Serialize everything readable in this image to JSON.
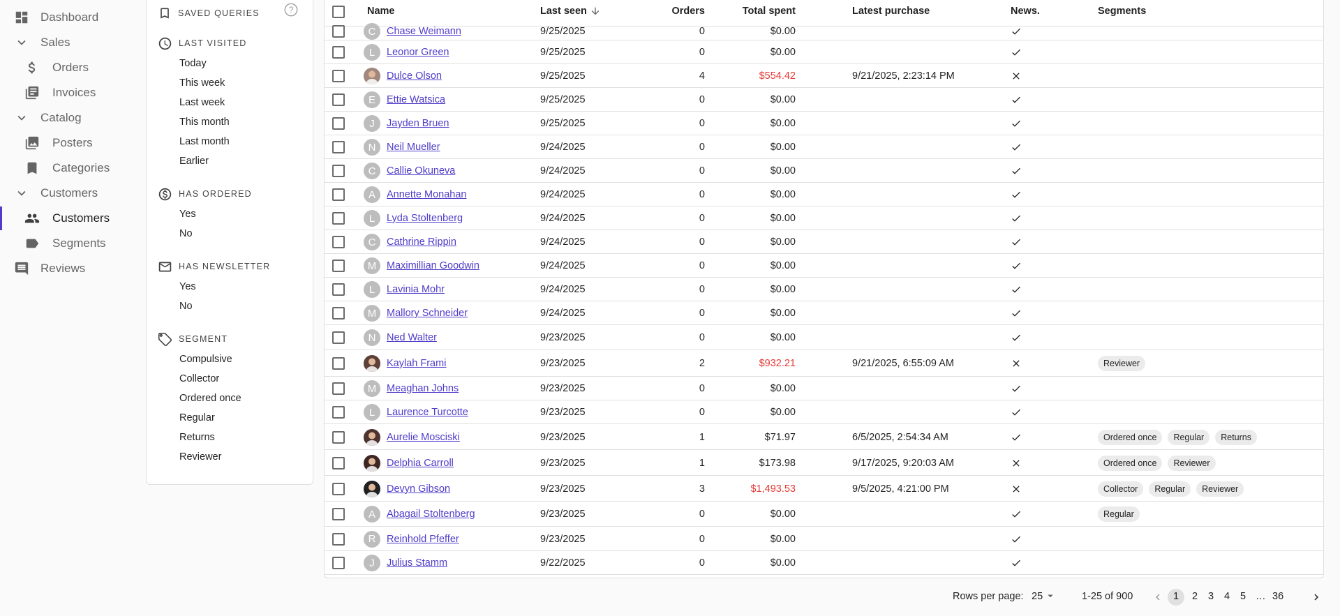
{
  "nav": {
    "items": [
      {
        "label": "Dashboard",
        "icon": "dashboard-icon",
        "level": 0,
        "active": false
      },
      {
        "label": "Sales",
        "icon": "chevron-down-icon",
        "level": 0,
        "active": false
      },
      {
        "label": "Orders",
        "icon": "dollar-icon",
        "level": 1,
        "active": false
      },
      {
        "label": "Invoices",
        "icon": "invoices-icon",
        "level": 1,
        "active": false
      },
      {
        "label": "Catalog",
        "icon": "chevron-down-icon",
        "level": 0,
        "active": false
      },
      {
        "label": "Posters",
        "icon": "posters-icon",
        "level": 1,
        "active": false
      },
      {
        "label": "Categories",
        "icon": "bookmark-icon",
        "level": 1,
        "active": false
      },
      {
        "label": "Customers",
        "icon": "chevron-down-icon",
        "level": 0,
        "active": false
      },
      {
        "label": "Customers",
        "icon": "people-icon",
        "level": 1,
        "active": true
      },
      {
        "label": "Segments",
        "icon": "label-icon",
        "level": 1,
        "active": false
      },
      {
        "label": "Reviews",
        "icon": "comment-icon",
        "level": 0,
        "active": false
      }
    ]
  },
  "filters": {
    "saved_queries": "Saved queries",
    "sections": [
      {
        "title": "Last visited",
        "icon": "clock-icon",
        "items": [
          "Today",
          "This week",
          "Last week",
          "This month",
          "Last month",
          "Earlier"
        ]
      },
      {
        "title": "Has ordered",
        "icon": "dollar-circle-icon",
        "items": [
          "Yes",
          "No"
        ]
      },
      {
        "title": "Has newsletter",
        "icon": "mail-icon",
        "items": [
          "Yes",
          "No"
        ]
      },
      {
        "title": "Segment",
        "icon": "tag-icon",
        "items": [
          "Compulsive",
          "Collector",
          "Ordered once",
          "Regular",
          "Returns",
          "Reviewer"
        ]
      }
    ]
  },
  "table": {
    "headers": {
      "name": "Name",
      "last_seen": "Last seen",
      "orders": "Orders",
      "total_spent": "Total spent",
      "latest_purchase": "Latest purchase",
      "news": "News.",
      "segments": "Segments"
    },
    "sort_icon": "arrow-down-icon",
    "rows": [
      {
        "name": "Chase Weimann",
        "initial": "C",
        "photo": false,
        "last_seen": "9/25/2025",
        "orders": "0",
        "spent": "$0.00",
        "red": false,
        "latest": "",
        "news": true,
        "segments": []
      },
      {
        "name": "Leonor Green",
        "initial": "L",
        "photo": false,
        "last_seen": "9/25/2025",
        "orders": "0",
        "spent": "$0.00",
        "red": false,
        "latest": "",
        "news": true,
        "segments": []
      },
      {
        "name": "Dulce Olson",
        "initial": "D",
        "photo": true,
        "photo_color": "#a1887f",
        "last_seen": "9/25/2025",
        "orders": "4",
        "spent": "$554.42",
        "red": true,
        "latest": "9/21/2025, 2:23:14 PM",
        "news": false,
        "segments": []
      },
      {
        "name": "Ettie Watsica",
        "initial": "E",
        "photo": false,
        "last_seen": "9/25/2025",
        "orders": "0",
        "spent": "$0.00",
        "red": false,
        "latest": "",
        "news": true,
        "segments": []
      },
      {
        "name": "Jayden Bruen",
        "initial": "J",
        "photo": false,
        "last_seen": "9/25/2025",
        "orders": "0",
        "spent": "$0.00",
        "red": false,
        "latest": "",
        "news": true,
        "segments": []
      },
      {
        "name": "Neil Mueller",
        "initial": "N",
        "photo": false,
        "last_seen": "9/24/2025",
        "orders": "0",
        "spent": "$0.00",
        "red": false,
        "latest": "",
        "news": true,
        "segments": []
      },
      {
        "name": "Callie Okuneva",
        "initial": "C",
        "photo": false,
        "last_seen": "9/24/2025",
        "orders": "0",
        "spent": "$0.00",
        "red": false,
        "latest": "",
        "news": true,
        "segments": []
      },
      {
        "name": "Annette Monahan",
        "initial": "A",
        "photo": false,
        "last_seen": "9/24/2025",
        "orders": "0",
        "spent": "$0.00",
        "red": false,
        "latest": "",
        "news": true,
        "segments": []
      },
      {
        "name": "Lyda Stoltenberg",
        "initial": "L",
        "photo": false,
        "last_seen": "9/24/2025",
        "orders": "0",
        "spent": "$0.00",
        "red": false,
        "latest": "",
        "news": true,
        "segments": []
      },
      {
        "name": "Cathrine Rippin",
        "initial": "C",
        "photo": false,
        "last_seen": "9/24/2025",
        "orders": "0",
        "spent": "$0.00",
        "red": false,
        "latest": "",
        "news": true,
        "segments": []
      },
      {
        "name": "Maximillian Goodwin",
        "initial": "M",
        "photo": false,
        "last_seen": "9/24/2025",
        "orders": "0",
        "spent": "$0.00",
        "red": false,
        "latest": "",
        "news": true,
        "segments": []
      },
      {
        "name": "Lavinia Mohr",
        "initial": "L",
        "photo": false,
        "last_seen": "9/24/2025",
        "orders": "0",
        "spent": "$0.00",
        "red": false,
        "latest": "",
        "news": true,
        "segments": []
      },
      {
        "name": "Mallory Schneider",
        "initial": "M",
        "photo": false,
        "last_seen": "9/24/2025",
        "orders": "0",
        "spent": "$0.00",
        "red": false,
        "latest": "",
        "news": true,
        "segments": []
      },
      {
        "name": "Ned Walter",
        "initial": "N",
        "photo": false,
        "last_seen": "9/23/2025",
        "orders": "0",
        "spent": "$0.00",
        "red": false,
        "latest": "",
        "news": true,
        "segments": []
      },
      {
        "name": "Kaylah Frami",
        "initial": "K",
        "photo": true,
        "photo_color": "#5d4037",
        "last_seen": "9/23/2025",
        "orders": "2",
        "spent": "$932.21",
        "red": true,
        "latest": "9/21/2025, 6:55:09 AM",
        "news": false,
        "segments": [
          "Reviewer"
        ]
      },
      {
        "name": "Meaghan Johns",
        "initial": "M",
        "photo": false,
        "last_seen": "9/23/2025",
        "orders": "0",
        "spent": "$0.00",
        "red": false,
        "latest": "",
        "news": true,
        "segments": []
      },
      {
        "name": "Laurence Turcotte",
        "initial": "L",
        "photo": false,
        "last_seen": "9/23/2025",
        "orders": "0",
        "spent": "$0.00",
        "red": false,
        "latest": "",
        "news": true,
        "segments": []
      },
      {
        "name": "Aurelie Mosciski",
        "initial": "A",
        "photo": true,
        "photo_color": "#4e342e",
        "last_seen": "9/23/2025",
        "orders": "1",
        "spent": "$71.97",
        "red": false,
        "latest": "6/5/2025, 2:54:34 AM",
        "news": true,
        "segments": [
          "Ordered once",
          "Regular",
          "Returns"
        ]
      },
      {
        "name": "Delphia Carroll",
        "initial": "D",
        "photo": true,
        "photo_color": "#3e2723",
        "last_seen": "9/23/2025",
        "orders": "1",
        "spent": "$173.98",
        "red": false,
        "latest": "9/17/2025, 9:20:03 AM",
        "news": false,
        "segments": [
          "Ordered once",
          "Reviewer"
        ]
      },
      {
        "name": "Devyn Gibson",
        "initial": "D",
        "photo": true,
        "photo_color": "#212121",
        "last_seen": "9/23/2025",
        "orders": "3",
        "spent": "$1,493.53",
        "red": true,
        "latest": "9/5/2025, 4:21:00 PM",
        "news": false,
        "segments": [
          "Collector",
          "Regular",
          "Reviewer"
        ]
      },
      {
        "name": "Abagail Stoltenberg",
        "initial": "A",
        "photo": false,
        "last_seen": "9/23/2025",
        "orders": "0",
        "spent": "$0.00",
        "red": false,
        "latest": "",
        "news": true,
        "segments": [
          "Regular"
        ]
      },
      {
        "name": "Reinhold Pfeffer",
        "initial": "R",
        "photo": false,
        "last_seen": "9/23/2025",
        "orders": "0",
        "spent": "$0.00",
        "red": false,
        "latest": "",
        "news": true,
        "segments": []
      },
      {
        "name": "Julius Stamm",
        "initial": "J",
        "photo": false,
        "last_seen": "9/22/2025",
        "orders": "0",
        "spent": "$0.00",
        "red": false,
        "latest": "",
        "news": true,
        "segments": []
      }
    ]
  },
  "pagination": {
    "rows_per_page_label": "Rows per page:",
    "rows_per_page": "25",
    "range": "1-25 of 900",
    "pages": [
      "1",
      "2",
      "3",
      "4",
      "5",
      "…",
      "36"
    ],
    "current": "1"
  },
  "colors": {
    "accent": "#4f3cc9",
    "red": "#e53935"
  }
}
